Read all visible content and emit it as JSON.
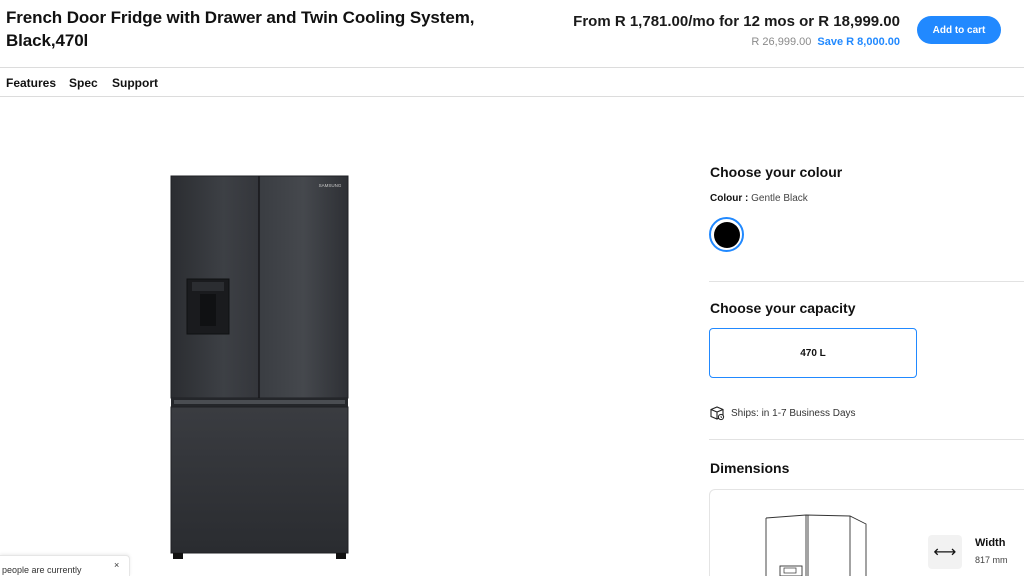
{
  "header": {
    "title": "French Door Fridge with Drawer and Twin Cooling System, Black,470l",
    "price_main": "From R 1,781.00/mo for 12 mos or R 18,999.00",
    "price_old": "R 26,999.00",
    "price_save": "Save R 8,000.00",
    "cart_label": "Add to cart"
  },
  "nav": {
    "items": [
      "Features",
      "Spec",
      "Support"
    ]
  },
  "options": {
    "colour_heading": "Choose your colour",
    "colour_label": "Colour :",
    "colour_value": "Gentle Black",
    "capacity_heading": "Choose your capacity",
    "capacity_value": "470 L",
    "ships_text": "Ships: in 1-7 Business Days"
  },
  "dimensions": {
    "heading": "Dimensions",
    "width_label": "Width",
    "width_value": "817 mm"
  },
  "product": {
    "brand": "SAMSUNG"
  },
  "toast": {
    "text": "people are currently",
    "close": "×"
  },
  "colors": {
    "accent": "#2189ff",
    "swatch": "#000000"
  }
}
